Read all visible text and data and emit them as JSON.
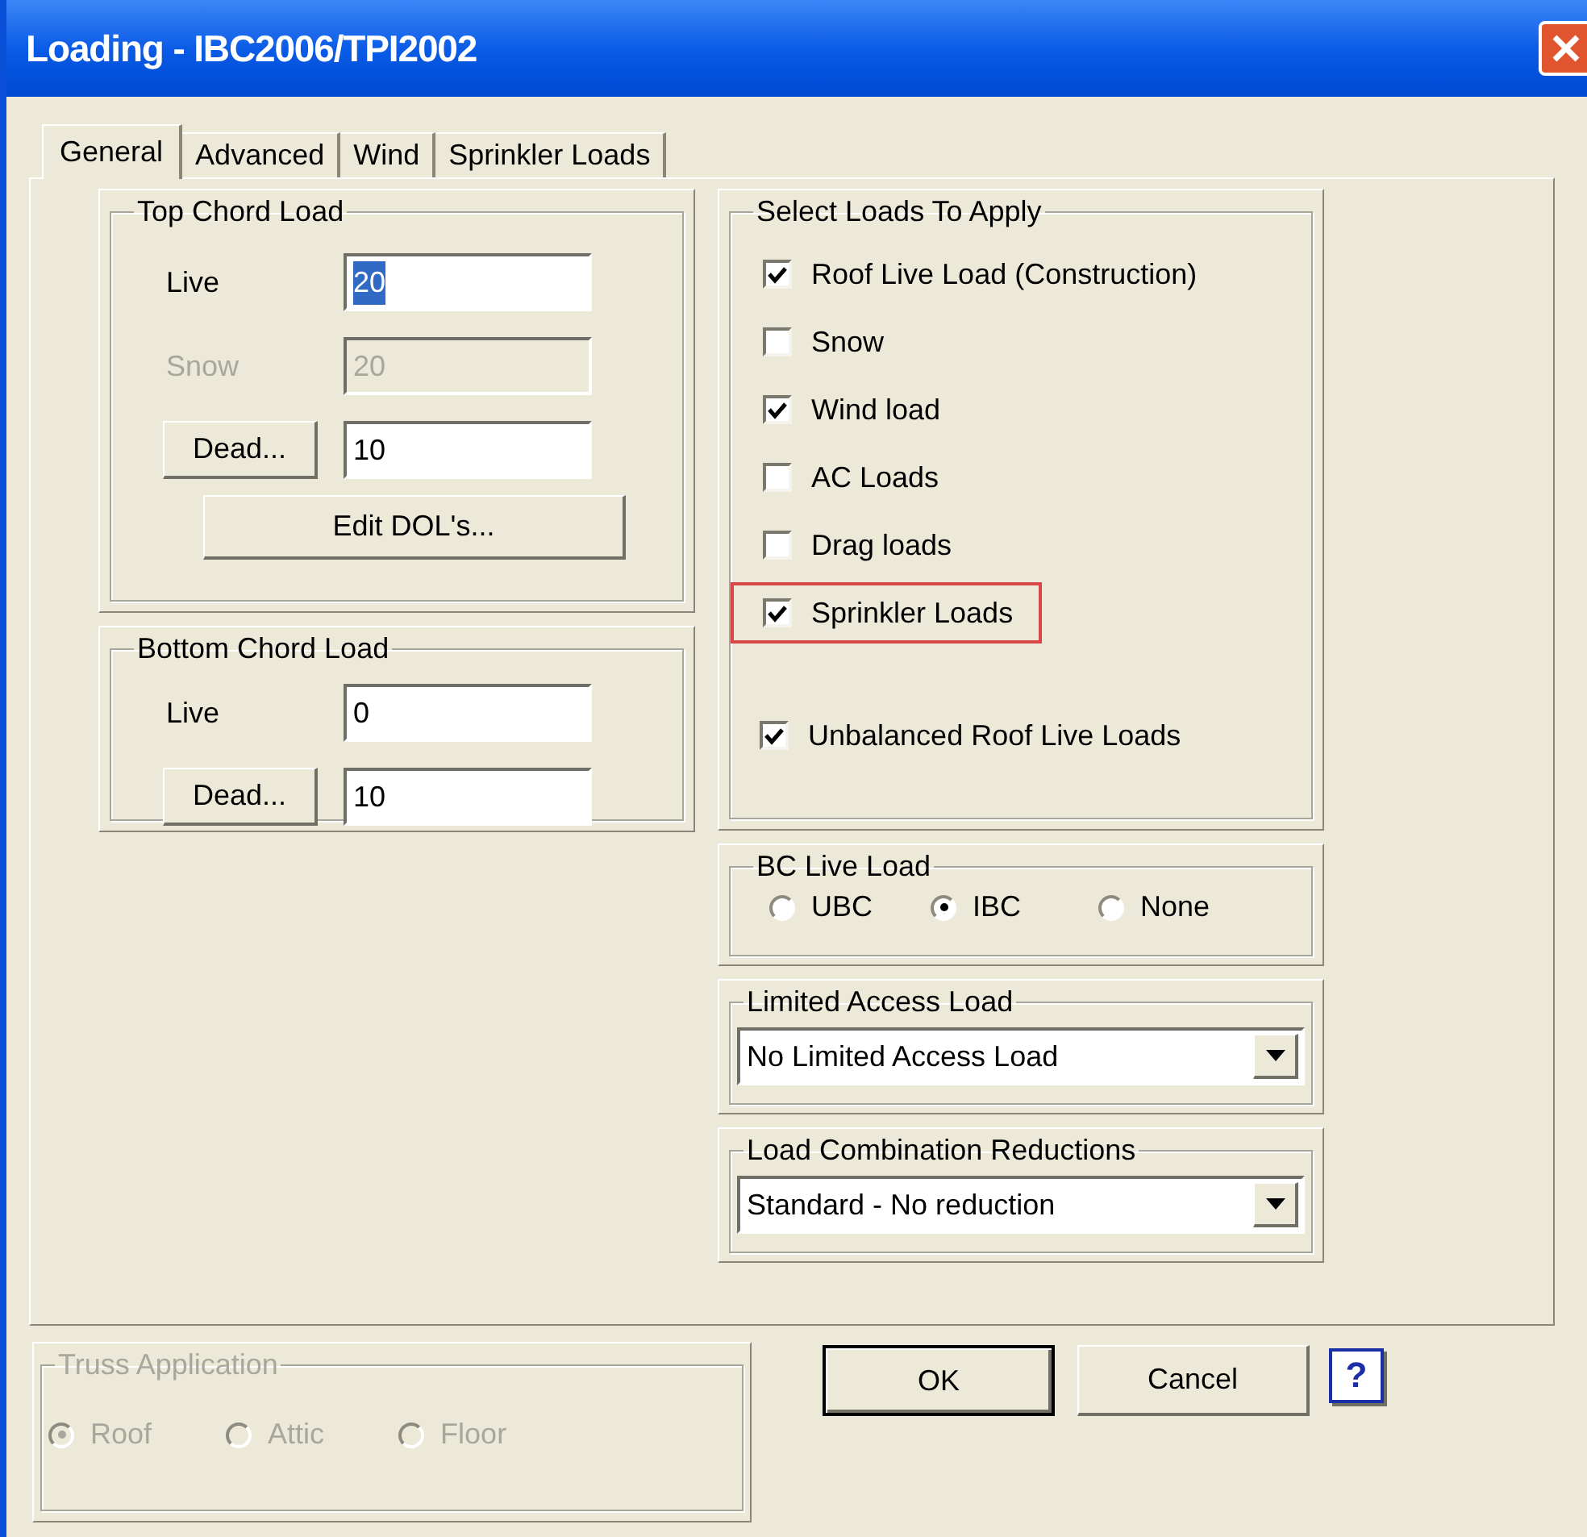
{
  "window": {
    "title": "Loading - IBC2006/TPI2002"
  },
  "tabs": [
    {
      "label": "General",
      "selected": true
    },
    {
      "label": "Advanced",
      "selected": false
    },
    {
      "label": "Wind",
      "selected": false
    },
    {
      "label": "Sprinkler Loads",
      "selected": false
    }
  ],
  "top_chord_load": {
    "title": "Top Chord Load",
    "fields": [
      {
        "kind": "label",
        "label": "Live",
        "value": "20",
        "disabled": false,
        "text_selected": true
      },
      {
        "kind": "label",
        "label": "Snow",
        "value": "20",
        "disabled": true,
        "text_selected": false
      },
      {
        "kind": "button",
        "label": "Dead...",
        "value": "10",
        "disabled": false,
        "text_selected": false
      }
    ],
    "button": "Edit DOL's..."
  },
  "bottom_chord_load": {
    "title": "Bottom Chord Load",
    "fields": [
      {
        "kind": "label",
        "label": "Live",
        "value": "0",
        "disabled": false,
        "text_selected": false
      },
      {
        "kind": "button",
        "label": "Dead...",
        "value": "10",
        "disabled": false,
        "text_selected": false
      }
    ]
  },
  "select_loads": {
    "title": "Select Loads To Apply",
    "options": [
      {
        "label": "Roof Live Load (Construction)",
        "checked": true,
        "highlighted": false
      },
      {
        "label": "Snow",
        "checked": false,
        "highlighted": false
      },
      {
        "label": "Wind load",
        "checked": true,
        "highlighted": false
      },
      {
        "label": "AC Loads",
        "checked": false,
        "highlighted": false
      },
      {
        "label": "Drag loads",
        "checked": false,
        "highlighted": false
      },
      {
        "label": "Sprinkler Loads",
        "checked": true,
        "highlighted": true
      }
    ],
    "extra_option": {
      "label": "Unbalanced Roof Live Loads",
      "checked": true
    }
  },
  "bc_live_load": {
    "title": "BC Live Load",
    "options": [
      {
        "label": "UBC",
        "selected": false
      },
      {
        "label": "IBC",
        "selected": true
      },
      {
        "label": "None",
        "selected": false
      }
    ]
  },
  "limited_access_load": {
    "title": "Limited Access Load",
    "value": "No Limited Access Load"
  },
  "load_combination_reductions": {
    "title": "Load Combination Reductions",
    "value": "Standard - No reduction"
  },
  "truss_application": {
    "title": "Truss Application",
    "disabled": true,
    "options": [
      {
        "label": "Roof",
        "selected": true
      },
      {
        "label": "Attic",
        "selected": false
      },
      {
        "label": "Floor",
        "selected": false
      }
    ]
  },
  "buttons": [
    {
      "label": "OK",
      "default": true
    },
    {
      "label": "Cancel",
      "default": false
    }
  ],
  "help_button": "?"
}
